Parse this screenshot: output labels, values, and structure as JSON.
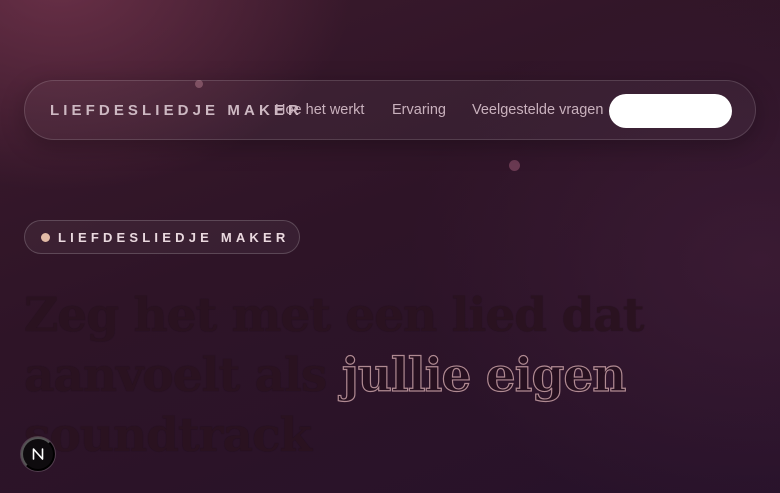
{
  "nav": {
    "brand": "LIEFDESLIEDJE MAKER",
    "links": [
      {
        "label": "Hoe het werkt"
      },
      {
        "label": "Ervaring"
      },
      {
        "label": "Veelgestelde vragen"
      }
    ],
    "cta_label": ""
  },
  "hero": {
    "badge": "LIEFDESLIEDJE MAKER",
    "headline_part1": "Zeg het met een lied dat aanvoelt als ",
    "headline_accent": "jullie eigen",
    "headline_part2": " soundtrack"
  },
  "dev_badge": {
    "icon": "nextjs-n-icon",
    "letter": "N"
  },
  "colors": {
    "background": "#2e1427",
    "brand_text": "#cdb8c2",
    "badge_dot": "#e2bba6",
    "cta_bg": "#ffffff"
  }
}
